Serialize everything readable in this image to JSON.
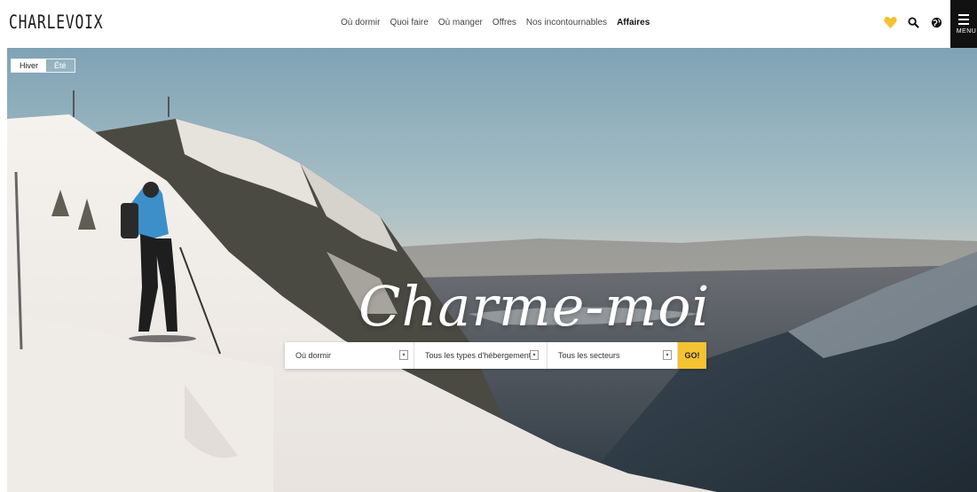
{
  "header": {
    "logo": "CHARLEVOIX",
    "nav": [
      "Où dormir",
      "Quoi faire",
      "Où manger",
      "Offres",
      "Nos incontournables",
      "Affaires"
    ],
    "menu_label": "MENU"
  },
  "icons": [
    "heart-icon",
    "search-icon",
    "globe-icon",
    "hamburger-icon"
  ],
  "colors": {
    "accent": "#f4c232",
    "menu_bg": "#111111"
  },
  "hero": {
    "season": {
      "active": "Hiver",
      "inactive": "Été"
    },
    "tagline": "Charme-moi"
  },
  "search": {
    "where": "Où dormir",
    "type": "Tous les types d'hébergement",
    "sector": "Tous les secteurs",
    "go": "GO!"
  }
}
